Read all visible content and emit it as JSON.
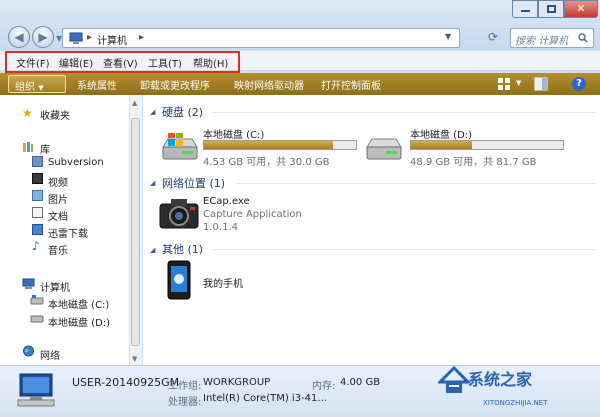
{
  "window": {
    "search_placeholder": "搜索 计算机"
  },
  "address": {
    "segments": [
      "计算机"
    ]
  },
  "menubar": {
    "items": [
      "文件(F)",
      "编辑(E)",
      "查看(V)",
      "工具(T)",
      "帮助(H)"
    ]
  },
  "toolbar": {
    "organize": "组织",
    "items": [
      "系统属性",
      "卸载或更改程序",
      "映射网络驱动器",
      "打开控制面板"
    ]
  },
  "nav": {
    "favorites": "收藏夹",
    "library": "库",
    "library_items": [
      "Subversion",
      "视频",
      "图片",
      "文档",
      "迅雷下载",
      "音乐"
    ],
    "computer": "计算机",
    "computer_items": [
      "本地磁盘 (C:)",
      "本地磁盘 (D:)"
    ],
    "network": "网络"
  },
  "content": {
    "hdd_group": "硬盘 (2)",
    "drives": [
      {
        "name": "本地磁盘 (C:)",
        "info": "4.53 GB 可用，共 30.0 GB",
        "used_fraction": 0.85
      },
      {
        "name": "本地磁盘 (D:)",
        "info": "48.9 GB 可用，共 81.7 GB",
        "used_fraction": 0.4
      }
    ],
    "net_group": "网络位置 (1)",
    "net_item": {
      "name": "ECap.exe",
      "desc": "Capture Application",
      "version": "1.0.1.4"
    },
    "other_group": "其他 (1)",
    "other_item": {
      "name": "我的手机"
    }
  },
  "details": {
    "computer_name": "USER-20140925GM",
    "workgroup_label": "工作组:",
    "workgroup": "WORKGROUP",
    "memory_label": "内存:",
    "memory": "4.00 GB",
    "cpu_label": "处理器:",
    "cpu": "Intel(R) Core(TM) i3-41..."
  },
  "watermark": {
    "brand": "系统之家",
    "site": "XITONGZHIJIA.NET"
  }
}
